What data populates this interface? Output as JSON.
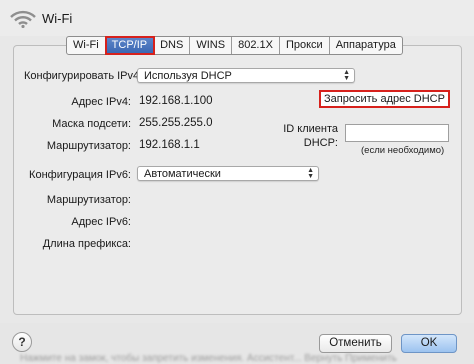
{
  "window": {
    "title": "Wi-Fi",
    "accent": "#3f72c9",
    "highlight": "#d7211c"
  },
  "tabs": [
    {
      "label": "Wi-Fi",
      "active": false
    },
    {
      "label": "TCP/IP",
      "active": true
    },
    {
      "label": "DNS",
      "active": false
    },
    {
      "label": "WINS",
      "active": false
    },
    {
      "label": "802.1X",
      "active": false
    },
    {
      "label": "Прокси",
      "active": false
    },
    {
      "label": "Аппаратура",
      "active": false
    }
  ],
  "ipv4": {
    "configure_label": "Конфигурировать IPv4:",
    "configure_value": "Используя DHCP",
    "address_label": "Адрес IPv4:",
    "address_value": "192.168.1.100",
    "mask_label": "Маска подсети:",
    "mask_value": "255.255.255.0",
    "router_label": "Маршрутизатор:",
    "router_value": "192.168.1.1",
    "renew_button": "Запросить адрес DHCP",
    "client_id_label_line1": "ID клиента",
    "client_id_label_line2": "DHCP:",
    "client_id_value": "",
    "client_id_hint": "(если необходимо)"
  },
  "ipv6": {
    "configure_label": "Конфигурация IPv6:",
    "configure_value": "Автоматически",
    "router_label": "Маршрутизатор:",
    "address_label": "Адрес IPv6:",
    "prefix_label": "Длина префикса:"
  },
  "footer": {
    "help_icon": "question-mark-icon",
    "cancel_label": "Отменить",
    "ok_label": "OK",
    "blurred_text": "Нажмите на замок, чтобы запретить изменения.       Ассистент...      Вернуть      Применить"
  }
}
